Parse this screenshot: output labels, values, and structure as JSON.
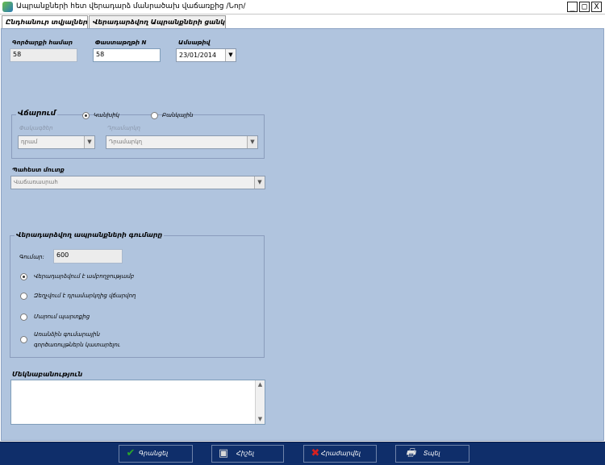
{
  "window": {
    "title": "Ապրանքների հետ վերադարձ մանրածախ վաճառքից /Նոր/",
    "minimize_glyph": "_",
    "maximize_glyph": "□",
    "close_glyph": "X"
  },
  "tabs": [
    {
      "label": "Ընդհանուր տվյալներ",
      "active": true
    },
    {
      "label": "Վերադարձվող Ապրանքների ցանկ",
      "active": false
    }
  ],
  "form": {
    "doc_number_label": "Գործարքի համար",
    "doc_number_value": "58",
    "receipt_number_label": "Փաստաթղթի N",
    "receipt_number_value": "58",
    "date_label": "Ամսաթիվ",
    "date_value": "23/01/2014",
    "payment": {
      "legend": "Վճարում",
      "cash_label": "Կանխիկ",
      "noncash_label": "Բանկային",
      "cash_selected": true,
      "cashier_label": "Փակագծեր",
      "cashier_value": "դրամ",
      "cashbox_label": "Դրամարկղ",
      "cashbox_value": "Դրամարկղ"
    },
    "storage_label": "Պահեստ մուտք",
    "storage_value": "Վաճառասրահ",
    "amount_group": {
      "legend": "Վերադարձվող ապրանքների գումարը",
      "amount_label": "Գումար:",
      "amount_value": "600",
      "options": [
        {
          "label": "Վերադարձվում է ամբողջությամբ",
          "selected": true
        },
        {
          "label": "Զեղչվում է դրամարկղից վճարվող",
          "selected": false
        },
        {
          "label": "Մարում պարտքից",
          "selected": false
        },
        {
          "label": "Առանձին գումարային",
          "label2": "գործառույթներն կատարելու",
          "selected": false
        }
      ]
    },
    "comment_label": "Մեկնաբանություն",
    "comment_value": ""
  },
  "toolbar": {
    "accept_label": "Գրանցել",
    "save_label": "Հիշել",
    "cancel_label": "Հրաժարվել",
    "print_label": "Տպել"
  },
  "colors": {
    "panel": "#b0c4de",
    "toolbar": "#0f2e6a",
    "accept_icon": "#2aa52a",
    "cancel_icon": "#d42020"
  }
}
